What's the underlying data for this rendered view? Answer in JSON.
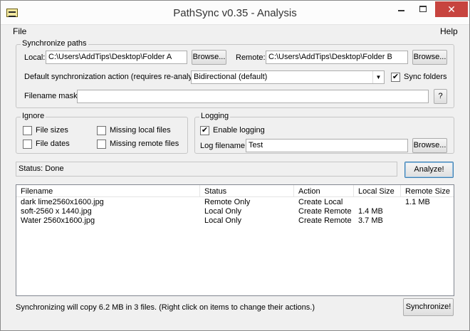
{
  "window": {
    "title": "PathSync v0.35 - Analysis",
    "controls": {
      "minimize": "min-icon",
      "maximize": "max-icon",
      "close": "✕"
    }
  },
  "menu": {
    "file": "File",
    "help": "Help"
  },
  "sync_paths": {
    "group_label": "Synchronize paths",
    "local_label": "Local:",
    "local_value": "C:\\Users\\AddTips\\Desktop\\Folder A",
    "browse_local": "Browse...",
    "remote_label": "Remote:",
    "remote_value": "C:\\Users\\AddTips\\Desktop\\Folder B",
    "browse_remote": "Browse...",
    "default_action_label": "Default synchronization action (requires re-analyze):",
    "default_action_value": "Bidirectional (default)",
    "sync_folders_label": "Sync folders",
    "sync_folders_checked": "✔",
    "mask_label": "Filename mask:",
    "mask_value": "",
    "mask_help": "?"
  },
  "ignore": {
    "group_label": "Ignore",
    "file_sizes": "File sizes",
    "file_dates": "File dates",
    "missing_local": "Missing local files",
    "missing_remote": "Missing remote files"
  },
  "logging": {
    "group_label": "Logging",
    "enable_label": "Enable logging",
    "enable_checked": "✔",
    "log_filename_label": "Log filename:",
    "log_filename_value": "Test",
    "browse_log": "Browse..."
  },
  "status": {
    "text": "Status: Done",
    "analyze_button": "Analyze!"
  },
  "table": {
    "columns": [
      "Filename",
      "Status",
      "Action",
      "Local Size",
      "Remote Size"
    ],
    "rows": [
      {
        "filename": "dark lime2560x1600.jpg",
        "status": "Remote Only",
        "action": "Create Local",
        "local_size": "",
        "remote_size": "1.1 MB"
      },
      {
        "filename": "soft-2560 x 1440.jpg",
        "status": "Local Only",
        "action": "Create Remote",
        "local_size": "1.4 MB",
        "remote_size": ""
      },
      {
        "filename": "Water 2560x1600.jpg",
        "status": "Local Only",
        "action": "Create Remote",
        "local_size": "3.7 MB",
        "remote_size": ""
      }
    ]
  },
  "footer": {
    "summary": "Synchronizing will copy 6.2 MB in 3 files. (Right click on items to change their actions.)",
    "synchronize_button": "Synchronize!"
  }
}
